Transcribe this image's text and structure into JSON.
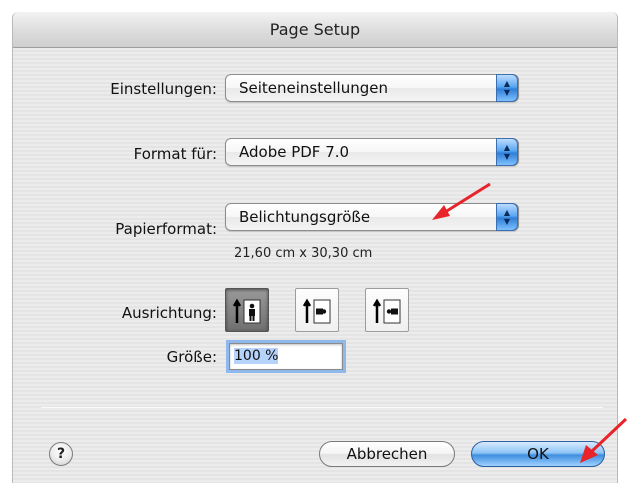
{
  "window": {
    "title": "Page Setup"
  },
  "settings": {
    "einstellungen": {
      "label": "Einstellungen:",
      "value": "Seiteneinstellungen"
    },
    "format_fuer": {
      "label": "Format für:",
      "value": "Adobe PDF 7.0"
    },
    "papierformat": {
      "label": "Papierformat:",
      "value": "Belichtungsgröße",
      "dimensions": "21,60 cm x 30,30 cm"
    },
    "ausrichtung": {
      "label": "Ausrichtung:",
      "options": [
        "portrait",
        "landscape-left",
        "landscape-right"
      ],
      "selected": "portrait"
    },
    "groesse": {
      "label": "Größe:",
      "value": "100 %"
    }
  },
  "buttons": {
    "help": "?",
    "cancel": "Abbrechen",
    "ok": "OK"
  },
  "colors": {
    "accent": "#3f8fe0",
    "annotation_arrow": "#e8232a"
  }
}
